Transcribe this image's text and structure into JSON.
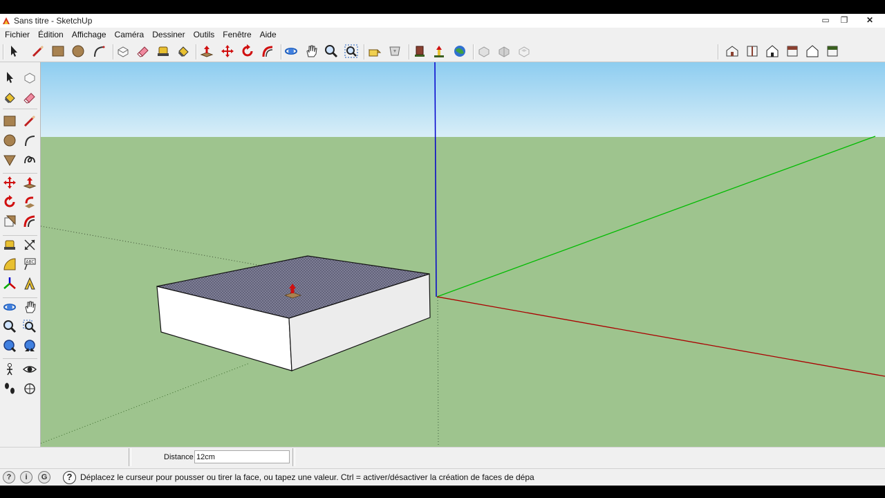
{
  "window": {
    "title": "Sans titre - SketchUp",
    "min_glyph": "▭",
    "max_glyph": "❐",
    "close_glyph": "✕"
  },
  "menu": [
    {
      "label": "Fichier"
    },
    {
      "label": "Édition"
    },
    {
      "label": "Affichage"
    },
    {
      "label": "Caméra"
    },
    {
      "label": "Dessiner"
    },
    {
      "label": "Outils"
    },
    {
      "label": "Fenêtre"
    },
    {
      "label": "Aide"
    }
  ],
  "toolbar_top": [
    {
      "name": "select-icon"
    },
    {
      "name": "pencil-icon"
    },
    {
      "name": "rectangle-icon"
    },
    {
      "name": "circle-icon"
    },
    {
      "name": "arc-icon"
    },
    {
      "name": "make-component-icon"
    },
    {
      "name": "eraser-icon"
    },
    {
      "name": "tape-measure-icon"
    },
    {
      "name": "paint-bucket-icon"
    },
    {
      "name": "push-pull-icon"
    },
    {
      "name": "move-icon"
    },
    {
      "name": "rotate-icon"
    },
    {
      "name": "follow-me-icon"
    },
    {
      "name": "orbit-icon"
    },
    {
      "name": "pan-icon"
    },
    {
      "name": "zoom-icon"
    },
    {
      "name": "zoom-extents-icon"
    },
    {
      "name": "get-models-icon"
    },
    {
      "name": "share-model-icon"
    },
    {
      "name": "component-icon"
    },
    {
      "name": "place-model-icon"
    },
    {
      "name": "google-earth-icon"
    },
    {
      "name": "section-icon"
    },
    {
      "name": "section-display-icon"
    },
    {
      "name": "section-cut-icon"
    },
    {
      "name": "iso-view-icon"
    },
    {
      "name": "top-view-icon"
    },
    {
      "name": "front-view-icon"
    },
    {
      "name": "right-view-icon"
    },
    {
      "name": "back-view-icon"
    },
    {
      "name": "left-view-icon"
    }
  ],
  "toolbar_left": [
    {
      "name": "select-icon"
    },
    {
      "name": "make-component-icon"
    },
    {
      "name": "paint-bucket-icon"
    },
    {
      "name": "eraser-icon"
    },
    {
      "name": "rectangle-icon"
    },
    {
      "name": "pencil-icon"
    },
    {
      "name": "circle-icon"
    },
    {
      "name": "arc-icon"
    },
    {
      "name": "polygon-icon"
    },
    {
      "name": "freehand-icon"
    },
    {
      "name": "move-icon"
    },
    {
      "name": "push-pull-icon"
    },
    {
      "name": "rotate-icon"
    },
    {
      "name": "follow-me-icon"
    },
    {
      "name": "scale-icon"
    },
    {
      "name": "offset-icon"
    },
    {
      "name": "tape-measure-icon"
    },
    {
      "name": "dimension-icon"
    },
    {
      "name": "protractor-icon"
    },
    {
      "name": "text-icon"
    },
    {
      "name": "axes-icon"
    },
    {
      "name": "3d-text-icon"
    },
    {
      "name": "orbit-icon"
    },
    {
      "name": "pan-icon"
    },
    {
      "name": "zoom-icon"
    },
    {
      "name": "zoom-window-icon"
    },
    {
      "name": "zoom-extents-icon"
    },
    {
      "name": "previous-view-icon"
    },
    {
      "name": "position-camera-icon"
    },
    {
      "name": "look-around-icon"
    },
    {
      "name": "walk-icon"
    },
    {
      "name": "section-plane-icon"
    }
  ],
  "colors": {
    "sky_top": "#8ecdf0",
    "sky_bottom": "#d8eef8",
    "ground": "#9ec48e",
    "axis_red": "#aa0000",
    "axis_green": "#00bb00",
    "axis_blue": "#0000cc",
    "selected_face": "#7e7e96"
  },
  "vcb": {
    "label": "Distance",
    "value": "12cm"
  },
  "status": {
    "icons": [
      "geo-location-icon",
      "credits-icon",
      "google-icon"
    ],
    "icon_glyphs": [
      "?",
      "i",
      "G"
    ],
    "help_glyph": "?",
    "text": "Déplacez le curseur pour pousser ou tirer la face, ou tapez une valeur.  Ctrl = activer/désactiver la création de faces de dépa"
  }
}
